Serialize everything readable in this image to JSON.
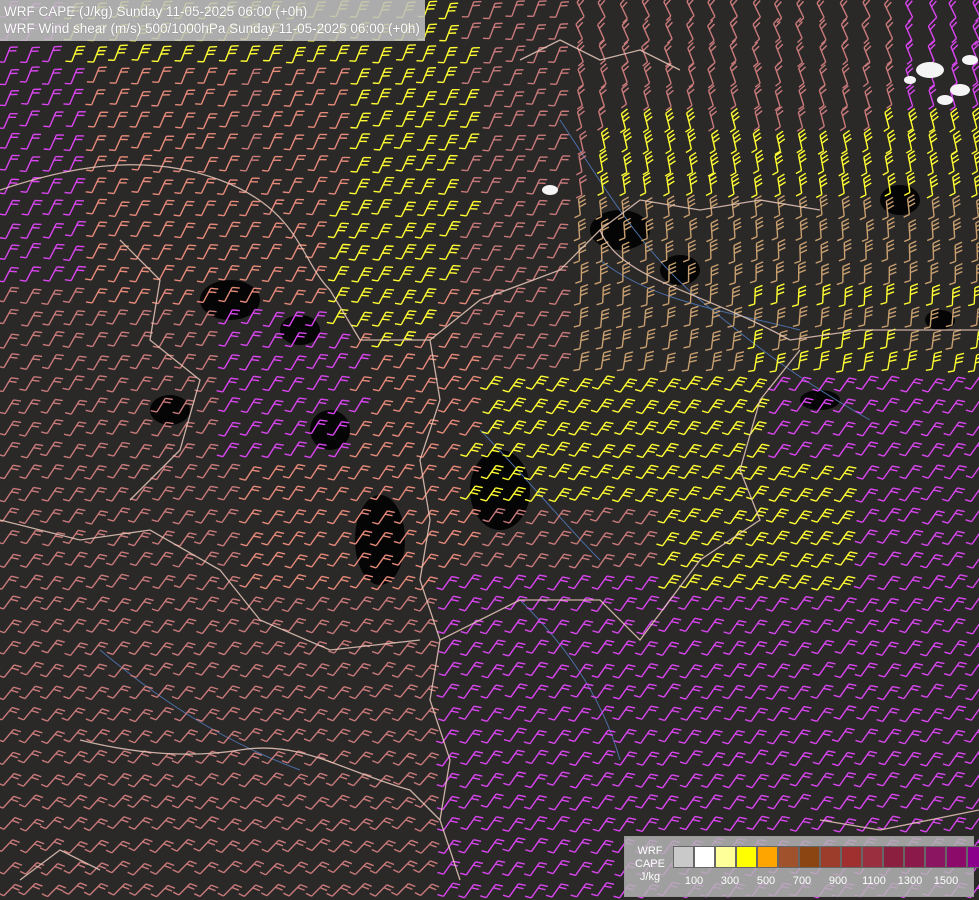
{
  "header": {
    "line1": "WRF CAPE (J/kg) Sunday 11-05-2025 06:00 (+0h)",
    "line2": "WRF Wind shear (m/s) 500/1000hPa Sunday 11-05-2025 06:00 (+0h)"
  },
  "legend": {
    "label_line1": "WRF",
    "label_line2": "CAPE",
    "label_line3": "J/kg",
    "colors": [
      "#c9c9c9",
      "#ffffff",
      "#ffff99",
      "#ffff00",
      "#ffa500",
      "#a0522d",
      "#8b4513",
      "#9b3d2a",
      "#a0302f",
      "#992f3f",
      "#8b1f3f",
      "#8b1a4a",
      "#8b1560",
      "#8b0a6a",
      "#8b008b"
    ],
    "ticks": [
      "100",
      "300",
      "500",
      "700",
      "900",
      "1100",
      "1300",
      "1500"
    ]
  },
  "map": {
    "barb_colors": {
      "low": "#c97a7a",
      "mid": "#e68a7a",
      "pink": "#d946ef",
      "tan": "#c8a070",
      "yellow": "#ffff33"
    },
    "border_color": "#e8c8b8",
    "river_color": "#4a6fa5"
  }
}
